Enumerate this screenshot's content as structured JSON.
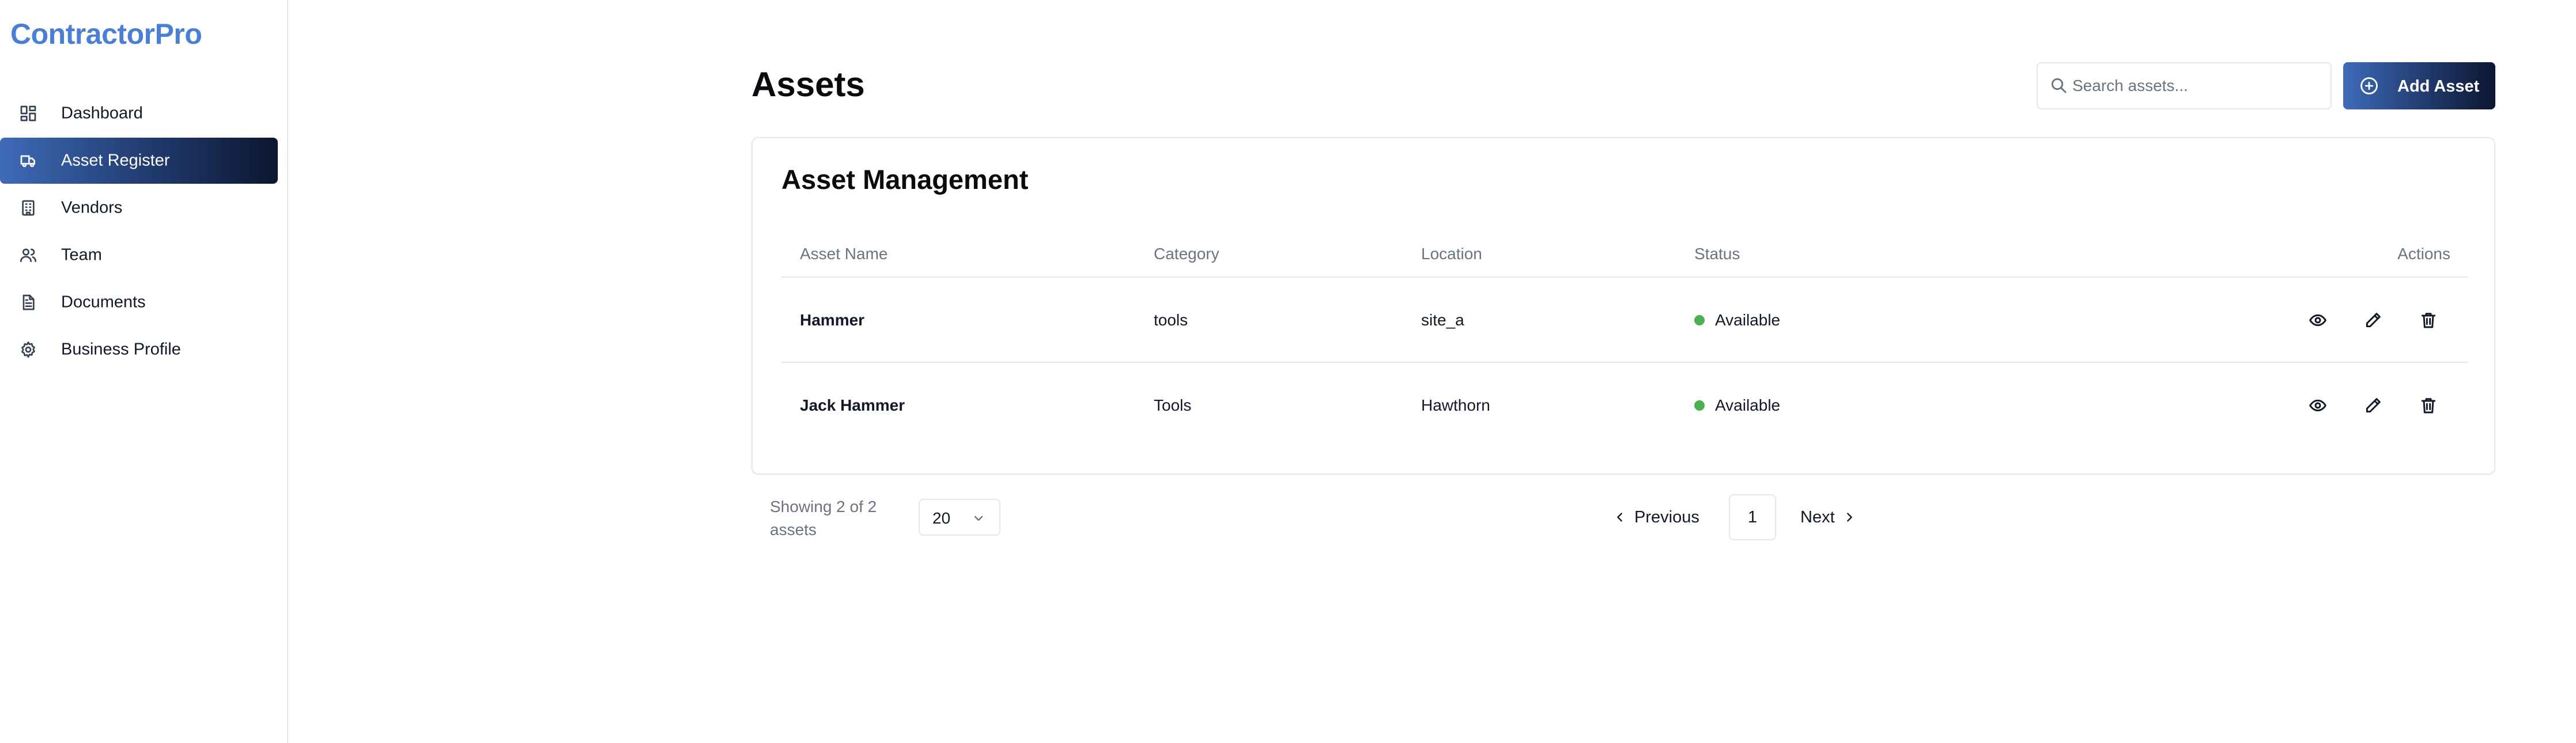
{
  "app": {
    "brand": "ContractorPro"
  },
  "sidebar": {
    "items": [
      {
        "label": "Dashboard",
        "icon": "dashboard-icon",
        "active": false
      },
      {
        "label": "Asset Register",
        "icon": "truck-icon",
        "active": true
      },
      {
        "label": "Vendors",
        "icon": "building-icon",
        "active": false
      },
      {
        "label": "Team",
        "icon": "users-icon",
        "active": false
      },
      {
        "label": "Documents",
        "icon": "document-icon",
        "active": false
      },
      {
        "label": "Business Profile",
        "icon": "gear-icon",
        "active": false
      }
    ]
  },
  "header": {
    "title": "Assets",
    "search_placeholder": "Search assets...",
    "search_value": "",
    "add_button_label": "Add Asset"
  },
  "card": {
    "title": "Asset Management",
    "columns": [
      "Asset Name",
      "Category",
      "Location",
      "Status",
      "Actions"
    ],
    "rows": [
      {
        "name": "Hammer",
        "category": "tools",
        "location": "site_a",
        "status": "Available"
      },
      {
        "name": "Jack Hammer",
        "category": "Tools",
        "location": "Hawthorn",
        "status": "Available"
      }
    ]
  },
  "pagination": {
    "showing_line1": "Showing 2 of 2",
    "showing_line2": "assets",
    "page_size": "20",
    "prev_label": "Previous",
    "current_page": "1",
    "next_label": "Next"
  },
  "colors": {
    "brand": "#4a7fd4",
    "accent_start": "#3f6bb8",
    "accent_end": "#0b1630",
    "status_available": "#4caf50"
  }
}
